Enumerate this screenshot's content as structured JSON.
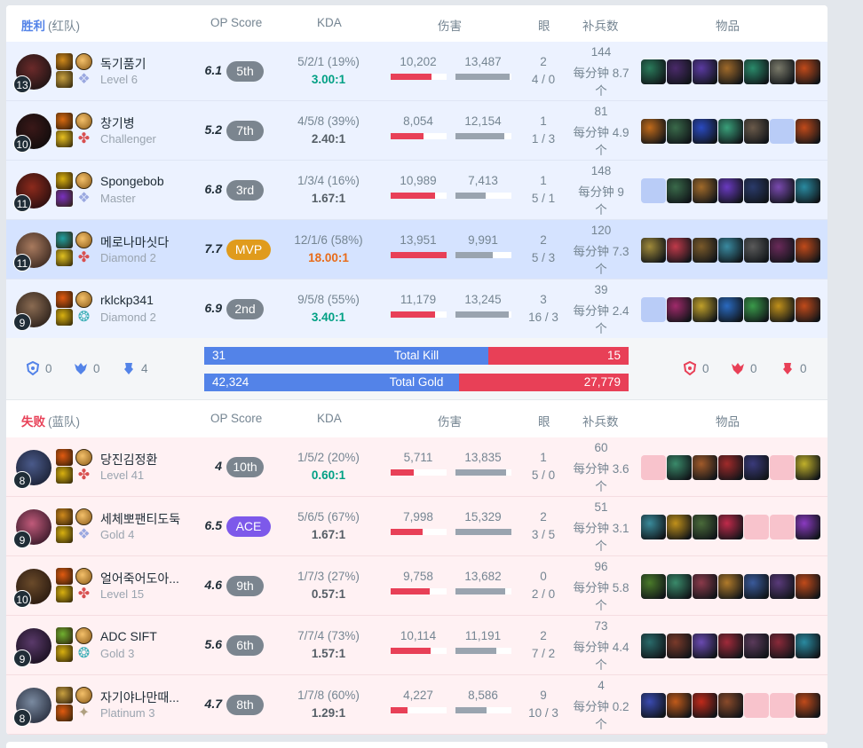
{
  "colors": {
    "win_blue": "#5383e8",
    "lose_red": "#e84057",
    "mvp_gold": "#e09b1c",
    "ace_purple": "#7d59ea",
    "kda_teal": "#00a084",
    "kda_orange": "#e86b1a"
  },
  "headers": {
    "win": {
      "result": "胜利",
      "team": "(红队)"
    },
    "lose": {
      "result": "失败",
      "team": "(蓝队)"
    },
    "op_score": "OP Score",
    "kda": "KDA",
    "damage": "伤害",
    "ward": "眼",
    "cs": "补兵数",
    "items": "物品"
  },
  "winners": [
    {
      "level": "13",
      "name": "독기품기",
      "tier": "Level 6",
      "op": "6.1",
      "rank": "5th",
      "kda": "5/2/1 (19%)",
      "ratio": "3.00:1",
      "dmg": "10,202",
      "taken": "13,487",
      "dmg_frac": 0.73,
      "taken_frac": 0.97,
      "ward_placed": "2",
      "ward_kd": "4 / 0",
      "cs": "144",
      "cs_pm": "每分钟 8.7",
      "cs_unit": "个"
    },
    {
      "level": "10",
      "name": "창기병",
      "tier": "Challenger",
      "op": "5.2",
      "rank": "7th",
      "kda": "4/5/8 (39%)",
      "ratio": "2.40:1",
      "dmg": "8,054",
      "taken": "12,154",
      "dmg_frac": 0.58,
      "taken_frac": 0.88,
      "ward_placed": "1",
      "ward_kd": "1 / 3",
      "cs": "81",
      "cs_pm": "每分钟 4.9",
      "cs_unit": "个"
    },
    {
      "level": "11",
      "name": "Spongebob",
      "tier": "Master",
      "op": "6.8",
      "rank": "3rd",
      "kda": "1/3/4 (16%)",
      "ratio": "1.67:1",
      "dmg": "10,989",
      "taken": "7,413",
      "dmg_frac": 0.79,
      "taken_frac": 0.54,
      "ward_placed": "1",
      "ward_kd": "5 / 1",
      "cs": "148",
      "cs_pm": "每分钟 9",
      "cs_unit": "个"
    },
    {
      "level": "11",
      "name": "메로나마싯다",
      "tier": "Diamond 2",
      "op": "7.7",
      "rank": "MVP",
      "kda": "12/1/6 (58%)",
      "ratio": "18.00:1",
      "dmg": "13,951",
      "taken": "9,991",
      "dmg_frac": 1.0,
      "taken_frac": 0.66,
      "ward_placed": "2",
      "ward_kd": "5 / 3",
      "cs": "120",
      "cs_pm": "每分钟 7.3",
      "cs_unit": "个"
    },
    {
      "level": "9",
      "name": "rklckp341",
      "tier": "Diamond 2",
      "op": "6.9",
      "rank": "2nd",
      "kda": "9/5/8 (55%)",
      "ratio": "3.40:1",
      "dmg": "11,179",
      "taken": "13,245",
      "dmg_frac": 0.8,
      "taken_frac": 0.95,
      "ward_placed": "3",
      "ward_kd": "16 / 3",
      "cs": "39",
      "cs_pm": "每分钟 2.4",
      "cs_unit": "个"
    }
  ],
  "summary": {
    "blue_objectives": [
      "0",
      "0",
      "4"
    ],
    "red_objectives": [
      "0",
      "0",
      "0"
    ],
    "kills": {
      "label": "Total Kill",
      "left": "31",
      "right": "15",
      "left_frac": 0.67
    },
    "gold": {
      "label": "Total Gold",
      "left": "42,324",
      "right": "27,779",
      "left_frac": 0.6
    }
  },
  "losers": [
    {
      "level": "8",
      "name": "당진김정환",
      "tier": "Level 41",
      "op": "4",
      "rank": "10th",
      "kda": "1/5/2 (20%)",
      "ratio": "0.60:1",
      "dmg": "5,711",
      "taken": "13,835",
      "dmg_frac": 0.41,
      "taken_frac": 0.9,
      "ward_placed": "1",
      "ward_kd": "5 / 0",
      "cs": "60",
      "cs_pm": "每分钟 3.6",
      "cs_unit": "个"
    },
    {
      "level": "9",
      "name": "세체뽀팬티도둑",
      "tier": "Gold 4",
      "op": "6.5",
      "rank": "ACE",
      "kda": "5/6/5 (67%)",
      "ratio": "1.67:1",
      "dmg": "7,998",
      "taken": "15,329",
      "dmg_frac": 0.57,
      "taken_frac": 1.0,
      "ward_placed": "2",
      "ward_kd": "3 / 5",
      "cs": "51",
      "cs_pm": "每分钟 3.1",
      "cs_unit": "个"
    },
    {
      "level": "10",
      "name": "얼어죽어도아...",
      "tier": "Level 15",
      "op": "4.6",
      "rank": "9th",
      "kda": "1/7/3 (27%)",
      "ratio": "0.57:1",
      "dmg": "9,758",
      "taken": "13,682",
      "dmg_frac": 0.7,
      "taken_frac": 0.89,
      "ward_placed": "0",
      "ward_kd": "2 / 0",
      "cs": "96",
      "cs_pm": "每分钟 5.8",
      "cs_unit": "个"
    },
    {
      "level": "9",
      "name": "ADC SIFT",
      "tier": "Gold 3",
      "op": "5.6",
      "rank": "6th",
      "kda": "7/7/4 (73%)",
      "ratio": "1.57:1",
      "dmg": "10,114",
      "taken": "11,191",
      "dmg_frac": 0.72,
      "taken_frac": 0.73,
      "ward_placed": "2",
      "ward_kd": "7 / 2",
      "cs": "73",
      "cs_pm": "每分钟 4.4",
      "cs_unit": "个"
    },
    {
      "level": "8",
      "name": "자기야나만때...",
      "tier": "Platinum 3",
      "op": "4.7",
      "rank": "8th",
      "kda": "1/7/8 (60%)",
      "ratio": "1.29:1",
      "dmg": "4,227",
      "taken": "8,586",
      "dmg_frac": 0.3,
      "taken_frac": 0.56,
      "ward_placed": "9",
      "ward_kd": "10 / 3",
      "cs": "4",
      "cs_pm": "每分钟 0.2",
      "cs_unit": "个"
    }
  ]
}
